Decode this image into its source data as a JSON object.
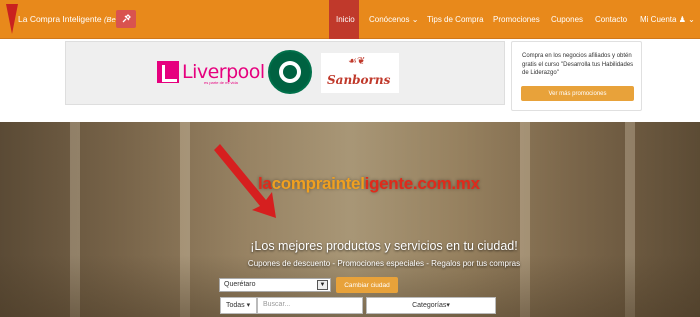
{
  "navbar": {
    "brand": "La Compra Inteligente",
    "brand_beta": "(Beta)",
    "items": [
      {
        "label": "Inicio"
      },
      {
        "label": "Conócenos"
      },
      {
        "label": "Tips de Compra"
      },
      {
        "label": "Promociones"
      },
      {
        "label": "Cupones"
      },
      {
        "label": "Contacto"
      },
      {
        "label": "Mi Cuenta"
      }
    ]
  },
  "ads": {
    "liverpool_logo_text": "Liverpool",
    "liverpool_tagline": "es parte de mi vida",
    "starbucks_logo": "starbucks-logo",
    "sanborns_logo_text": "Sanborns",
    "side_text": "Compra en los negocios afiliados y obtén gratis el curso \"Desarrolla tus Habilidades de Liderazgo\"",
    "side_button": "Ver más promociones"
  },
  "hero": {
    "site_url_part1": "la",
    "site_url_part2": "compraintel",
    "site_url_part3": "igente.com.mx",
    "title": "¡Los mejores productos y servicios en tu ciudad!",
    "subtitle": "Cupones de descuento - Promociones especiales - Regalos por tus compras",
    "city_value": "Querétaro",
    "change_city_button": "Cambiar ciudad",
    "filter_value": "Todas",
    "search_placeholder": "Buscar...",
    "categories_label": "Categorías"
  },
  "colors": {
    "navbar": "#e8891b",
    "active_nav": "#c0392b",
    "accent_button": "#e8a23a",
    "annotation_arrow": "#d61f1f"
  }
}
